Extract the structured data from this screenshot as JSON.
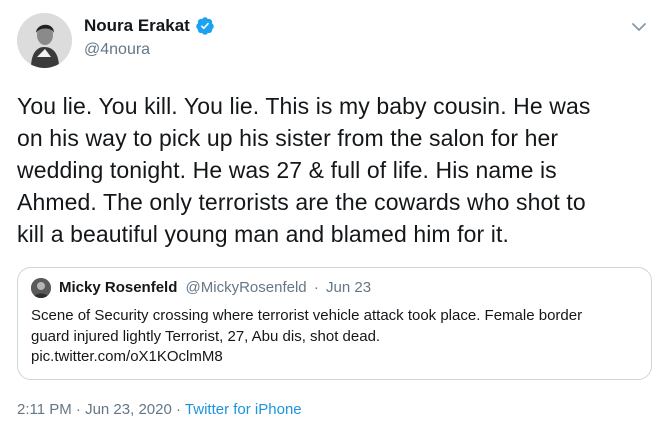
{
  "author": {
    "display_name": "Noura Erakat",
    "handle": "@4noura",
    "verified_icon": "verified-badge-icon",
    "accent_color": "#1da1f2"
  },
  "tweet": {
    "lines": [
      "You lie. You kill. You lie. This is my baby cousin. He was",
      "on his way to pick up his sister from the salon for her",
      "wedding tonight. He was 27 & full of life. His name is",
      "Ahmed. The only terrorists are the cowards who shot to",
      "kill a beautiful young man and blamed him for it."
    ]
  },
  "quoted_tweet": {
    "display_name": "Micky Rosenfeld",
    "handle": "@MickyRosenfeld",
    "separator": "·",
    "date": "Jun 23",
    "lines": [
      "Scene of Security crossing where terrorist vehicle attack took place. Female border",
      "guard injured lightly Terrorist, 27, Abu dis, shot dead.",
      "pic.twitter.com/oX1KOclmM8"
    ]
  },
  "footer": {
    "timestamp": "2:11 PM · Jun 23, 2020",
    "separator": "·",
    "source": "Twitter for iPhone",
    "link_color": "#1b95e0"
  },
  "icons": {
    "menu": "chevron-down-icon"
  }
}
